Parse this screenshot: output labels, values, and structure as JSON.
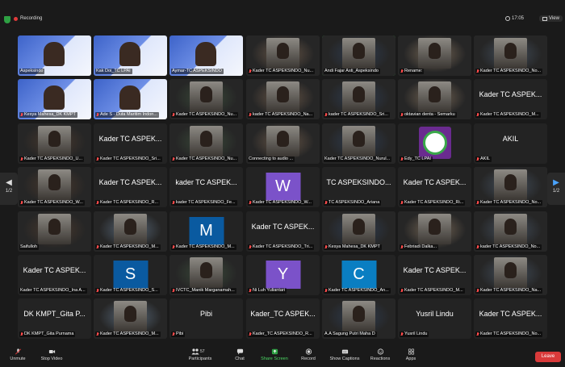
{
  "topbar": {
    "recording_label": "Recording",
    "time": "17:05",
    "view_label": "View"
  },
  "nav": {
    "left_page": "1/2",
    "right_page": "1/2"
  },
  "tiles": [
    {
      "name": "Aspeksindo",
      "kind": "slide"
    },
    {
      "name": "Kak Doi_TC LPAI",
      "kind": "slide"
    },
    {
      "name": "Aymar-TC ASPEKSINDO",
      "kind": "slide"
    },
    {
      "name": "Kader TC ASPEKSINDO_Nu...",
      "kind": "video",
      "muted": true
    },
    {
      "name": "Andi Fajar Asti_Aspeksindo",
      "kind": "video",
      "muted": false,
      "active": true
    },
    {
      "name": "Rename:",
      "kind": "video",
      "muted": true
    },
    {
      "name": "Kader TC ASPEKSINDO_No...",
      "kind": "video",
      "muted": true
    },
    {
      "name": "Kesya Mahesa_DK KMPT",
      "kind": "slide",
      "muted": true
    },
    {
      "name": "Ade S - Duta Maritim Indon...",
      "kind": "slide",
      "muted": true
    },
    {
      "name": "Kader TC ASPEKSINDO_Nu...",
      "kind": "video",
      "muted": true
    },
    {
      "name": "kader TC ASPEKSINDO_Na...",
      "kind": "video",
      "muted": true
    },
    {
      "name": "kader TC ASPEKSINDO_Sri...",
      "kind": "video",
      "muted": true
    },
    {
      "name": "oktavian denta - Semarku",
      "kind": "video",
      "muted": true
    },
    {
      "name": "Kader TC ASPEKSINDO_M...",
      "kind": "text",
      "big": "Kader TC ASPEK...",
      "muted": true
    },
    {
      "name": "Kader TC ASPEKSINDO_U...",
      "kind": "video",
      "muted": true
    },
    {
      "name": "Kader TC ASPEKSINDO_Sri...",
      "kind": "text",
      "big": "Kader TC ASPEK...",
      "muted": true
    },
    {
      "name": "Kader TC ASPEKSINDO_Nu...",
      "kind": "video",
      "muted": true
    },
    {
      "name": "Connecting to audio ...",
      "kind": "video",
      "muted": false
    },
    {
      "name": "Kader TC ASPEKSINDO_Nurul...",
      "kind": "video",
      "muted": false
    },
    {
      "name": "Edy_TC LPAI",
      "kind": "logo",
      "muted": true
    },
    {
      "name": "AKIL",
      "kind": "text",
      "big": "AKIL",
      "muted": true
    },
    {
      "name": "Kader TC ASPEKSINDO_W...",
      "kind": "video",
      "muted": true
    },
    {
      "name": "Kader TC ASPEKSINDO_R...",
      "kind": "text",
      "big": "Kader TC ASPEK...",
      "muted": true
    },
    {
      "name": "kader TC ASPEKSINDO_Fe...",
      "kind": "text",
      "big": "kader TC ASPEK...",
      "muted": true
    },
    {
      "name": "Kader TC ASPEKSINDO_W...",
      "kind": "letter",
      "letter": "W",
      "color": "#7b52c9",
      "muted": true
    },
    {
      "name": "TC ASPEKSINDO_Ariana",
      "kind": "text",
      "big": "TC ASPEKSINDO...",
      "muted": true
    },
    {
      "name": "Kader TC ASPEKSINDO_Ri...",
      "kind": "text",
      "big": "Kader TC ASPEK...",
      "muted": true
    },
    {
      "name": "Kader TC ASPEKSINDO_No...",
      "kind": "video",
      "muted": true
    },
    {
      "name": "Saifulloh",
      "kind": "video",
      "muted": false
    },
    {
      "name": "Kader TC ASPEKSINDO_M...",
      "kind": "video",
      "muted": true
    },
    {
      "name": "Kader TC ASPEKSINDO_M...",
      "kind": "letter",
      "letter": "M",
      "color": "#0a5aa0",
      "muted": true
    },
    {
      "name": "Kader TC ASPEKSINDO_Tri...",
      "kind": "text",
      "big": "Kader TC ASPEK...",
      "muted": true
    },
    {
      "name": "Kesya Mahesa_DK KMPT",
      "kind": "video",
      "muted": true
    },
    {
      "name": "Febriadi Dalka...",
      "kind": "video",
      "muted": true
    },
    {
      "name": "kader TC ASPEKSINDO_No...",
      "kind": "video",
      "muted": true
    },
    {
      "name": "Kader TC ASPEKSINDO_Ina A...",
      "kind": "text",
      "big": "Kader TC ASPEK...",
      "muted": false
    },
    {
      "name": "Kader TC ASPEKSINDO_S...",
      "kind": "letter",
      "letter": "S",
      "color": "#0a5aa0",
      "muted": true
    },
    {
      "name": "IVCTC_Manik Marganamah...",
      "kind": "video",
      "muted": true
    },
    {
      "name": "Ni Luh Yuliantari",
      "kind": "letter",
      "letter": "Y",
      "color": "#7b52c9",
      "muted": true
    },
    {
      "name": "Kader TC ASPEKSINDO_An...",
      "kind": "letter",
      "letter": "C",
      "color": "#0a7ec2",
      "muted": true
    },
    {
      "name": "Kader TC ASPEKSINDO_M...",
      "kind": "text",
      "big": "Kader TC ASPEK...",
      "muted": true
    },
    {
      "name": "Kader TC ASPEKSINDO_Na...",
      "kind": "video",
      "muted": true
    },
    {
      "name": "DK KMPT_Gita Purnama",
      "kind": "text",
      "big": "DK KMPT_Gita P...",
      "muted": true
    },
    {
      "name": "Kader TC ASPEKSINDO_M...",
      "kind": "video",
      "muted": true
    },
    {
      "name": "Pibi",
      "kind": "text",
      "big": "Pibi",
      "muted": true
    },
    {
      "name": "Kader_TC ASPEKSINDO_R...",
      "kind": "text",
      "big": "Kader_TC ASPEK...",
      "muted": true
    },
    {
      "name": "A.A Sagung Putri Maha D",
      "kind": "video",
      "muted": false
    },
    {
      "name": "Yusril Lindu",
      "kind": "text",
      "big": "Yusril Lindu",
      "muted": true
    },
    {
      "name": "Kader TC ASPEKSINDO_No...",
      "kind": "text",
      "big": "Kader TC ASPEK...",
      "muted": true
    }
  ],
  "toolbar": {
    "unmute": "Unmute",
    "stop_video": "Stop Video",
    "participants": "Participants",
    "participants_count": "57",
    "chat": "Chat",
    "share_screen": "Share Screen",
    "record": "Record",
    "show_captions": "Show Captions",
    "reactions": "Reactions",
    "apps": "Apps",
    "leave": "Leave"
  }
}
